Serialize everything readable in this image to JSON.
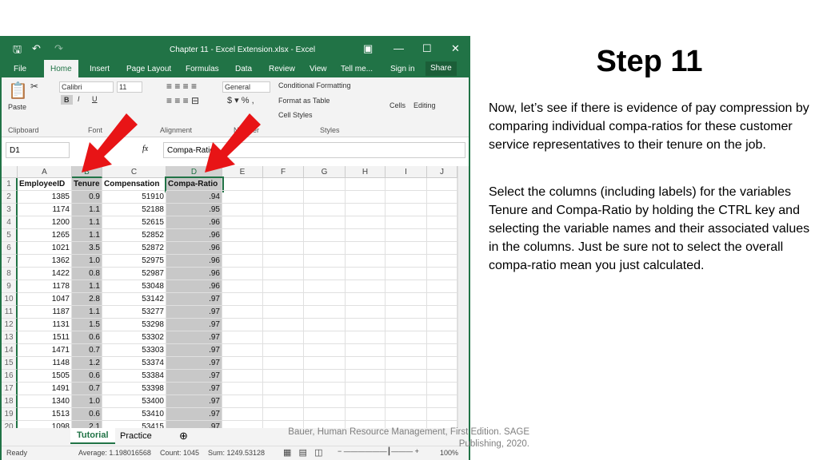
{
  "window": {
    "title": "Chapter 11 - Excel Extension.xlsx - Excel"
  },
  "menu": {
    "tabs": [
      "File",
      "Home",
      "Insert",
      "Page Layout",
      "Formulas",
      "Data",
      "Review",
      "View",
      "Tell me...",
      "Sign in",
      "Share"
    ]
  },
  "ribbon": {
    "font_name": "Calibri",
    "font_size": "11",
    "number_format": "General",
    "conditional_formatting": "Conditional Formatting",
    "format_as_table": "Format as Table",
    "cell_styles": "Cell Styles",
    "cells": "Cells",
    "editing": "Editing",
    "paste": "Paste",
    "groups": [
      "Clipboard",
      "Font",
      "Alignment",
      "Number",
      "Styles"
    ]
  },
  "formula_bar": {
    "name_box": "D1",
    "fx": "fx",
    "value": "Compa-Ratio"
  },
  "columns": [
    "A",
    "B",
    "C",
    "D",
    "E",
    "F",
    "G",
    "H",
    "I",
    "J"
  ],
  "headers": [
    "EmployeeID",
    "Tenure",
    "Compensation",
    "Compa-Ratio"
  ],
  "rows": [
    [
      "1385",
      "0.9",
      "51910",
      ".94"
    ],
    [
      "1174",
      "1.1",
      "52188",
      ".95"
    ],
    [
      "1200",
      "1.1",
      "52615",
      ".96"
    ],
    [
      "1265",
      "1.1",
      "52852",
      ".96"
    ],
    [
      "1021",
      "3.5",
      "52872",
      ".96"
    ],
    [
      "1362",
      "1.0",
      "52975",
      ".96"
    ],
    [
      "1422",
      "0.8",
      "52987",
      ".96"
    ],
    [
      "1178",
      "1.1",
      "53048",
      ".96"
    ],
    [
      "1047",
      "2.8",
      "53142",
      ".97"
    ],
    [
      "1187",
      "1.1",
      "53277",
      ".97"
    ],
    [
      "1131",
      "1.5",
      "53298",
      ".97"
    ],
    [
      "1511",
      "0.6",
      "53302",
      ".97"
    ],
    [
      "1471",
      "0.7",
      "53303",
      ".97"
    ],
    [
      "1148",
      "1.2",
      "53374",
      ".97"
    ],
    [
      "1505",
      "0.6",
      "53384",
      ".97"
    ],
    [
      "1491",
      "0.7",
      "53398",
      ".97"
    ],
    [
      "1340",
      "1.0",
      "53400",
      ".97"
    ],
    [
      "1513",
      "0.6",
      "53410",
      ".97"
    ],
    [
      "1098",
      "2.1",
      "53415",
      ".97"
    ]
  ],
  "sheet_tabs": [
    "Tutorial",
    "Practice"
  ],
  "status": {
    "ready": "Ready",
    "average": "Average: 1.198016568",
    "count": "Count: 1045",
    "sum": "Sum: 1249.53128",
    "zoom": "100%"
  },
  "slide": {
    "title": "Step 11",
    "p1": "Now, let’s see if there is evidence of pay compression by comparing individual compa-ratios for these customer service representatives to their tenure on the job.",
    "p2": "Select the columns (including labels) for the variables Tenure and Compa-Ratio by holding the CTRL key and selecting the variable names and their associated values in the columns. Just be sure not to select the overall compa-ratio mean you just calculated.",
    "citation": "Bauer, Human Resource Management, First Edition. SAGE Publishing, 2020."
  },
  "colors": {
    "excel_green": "#217346",
    "arrow": "#e81416",
    "selection": "#c8c8c8"
  }
}
